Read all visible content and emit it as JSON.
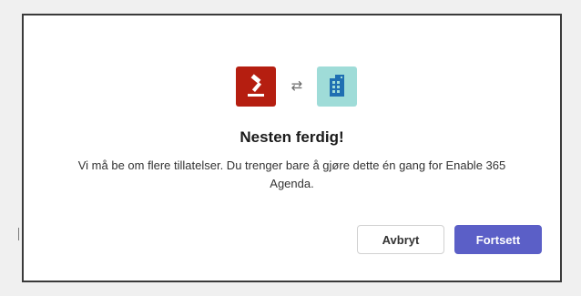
{
  "dialog": {
    "icons": {
      "app": "gavel-icon",
      "swap": "swap-arrows-icon",
      "org": "building-icon",
      "swap_glyph": "⇄"
    },
    "title": "Nesten ferdig!",
    "message": "Vi må be om flere tillatelser. Du trenger bare å gjøre dette én gang for Enable 365 Agenda.",
    "buttons": {
      "cancel_label": "Avbryt",
      "continue_label": "Fortsett"
    }
  },
  "colors": {
    "app_icon_bg": "#b51e10",
    "org_icon_bg": "#9fdcd8",
    "primary_button": "#5b5fc7"
  }
}
